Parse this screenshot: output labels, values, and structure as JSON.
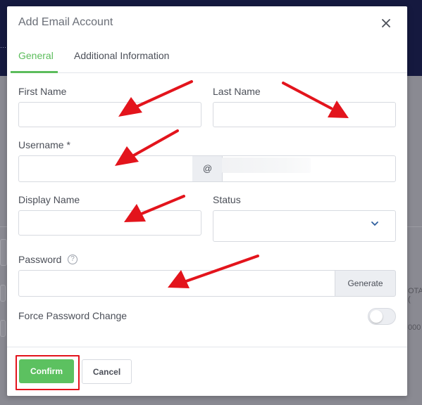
{
  "modal": {
    "title": "Add Email Account",
    "tabs": [
      {
        "label": "General",
        "active": true
      },
      {
        "label": "Additional Information",
        "active": false
      }
    ]
  },
  "form": {
    "first_name": {
      "label": "First Name",
      "value": ""
    },
    "last_name": {
      "label": "Last Name",
      "value": ""
    },
    "username": {
      "label": "Username *",
      "value": "",
      "at_symbol": "@",
      "domain": ""
    },
    "display_name": {
      "label": "Display Name",
      "value": ""
    },
    "status": {
      "label": "Status",
      "value": ""
    },
    "password": {
      "label": "Password",
      "help_icon": "?",
      "value": "",
      "generate_label": "Generate"
    },
    "force_password_change": {
      "label": "Force Password Change",
      "enabled": false
    }
  },
  "footer": {
    "confirm_label": "Confirm",
    "cancel_label": "Cancel"
  },
  "background": {
    "fragments": [
      "OTA (",
      "000"
    ]
  },
  "colors": {
    "accent": "#5cbd5c",
    "confirm": "#5cc160",
    "annotation": "#e3141c",
    "topbar": "#15193f"
  },
  "icons": [
    "close-icon",
    "chevron-down-icon",
    "help-icon",
    "annotation-arrow-icon"
  ]
}
